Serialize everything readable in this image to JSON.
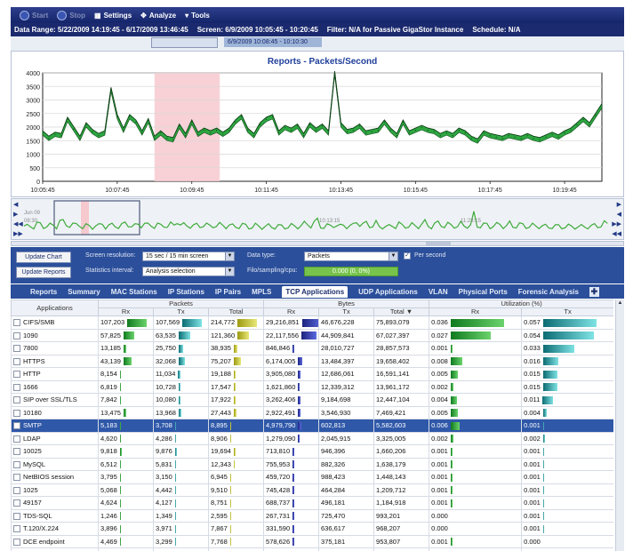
{
  "toolbar": {
    "start_label": "Start",
    "stop_label": "Stop",
    "settings_label": "Settings",
    "analyze_label": "Analyze",
    "tools_label": "Tools"
  },
  "range_bar": {
    "data_range": "Data Range: 5/22/2009 14:19:45 - 6/17/2009 13:46:45",
    "screen": "Screen: 6/9/2009 10:05:45 - 10:20:45",
    "filter": "Filter: N/A for Passive GigaStor Instance",
    "schedule": "Schedule: N/A"
  },
  "slider_label": "6/9/2009 10:08:45 - 10:10:30",
  "chart_data": {
    "type": "line",
    "title": "Reports - Packets/Second",
    "categories": [
      "10:05:45",
      "10:07:45",
      "10:09:45",
      "10:11:45",
      "10:13:45",
      "10:15:45",
      "10:17:45",
      "10:19:45"
    ],
    "y_ticks": [
      0,
      500,
      1000,
      1500,
      2000,
      2500,
      3000,
      3500,
      4000
    ],
    "ylim": [
      0,
      4000
    ],
    "xlim": [
      0,
      900
    ],
    "highlight": {
      "from": 180,
      "to": 285
    },
    "series": [
      {
        "color": "#2ea641",
        "values": [
          1700,
          1500,
          1650,
          1600,
          2200,
          1850,
          1500,
          2000,
          1750,
          1600,
          1700,
          3300,
          2300,
          1800,
          2300,
          2100,
          1700,
          2150,
          1500,
          1700,
          1500,
          1450,
          1950,
          1600,
          2100,
          1650,
          1800,
          1700,
          1800,
          1650,
          1800,
          2100,
          2300,
          1800,
          1600,
          2000,
          2200,
          2300,
          1700,
          1900,
          1800,
          1950,
          1600,
          2000,
          1800,
          1950,
          1700,
          3900,
          2000,
          1750,
          1800,
          1950,
          1700,
          1750,
          1800,
          2100,
          1800,
          1600,
          2100,
          1700,
          1800,
          1900,
          1800,
          1750,
          1600,
          1700,
          1600,
          1800,
          1700,
          1500,
          1400,
          1700,
          1600,
          1550,
          1500,
          1600,
          1550,
          1500,
          1600,
          1500,
          1450,
          1550,
          1650,
          1550,
          1700,
          1800,
          2000,
          2200,
          2000,
          2350,
          2700
        ]
      }
    ]
  },
  "overview": {
    "left_top": "Jun 09",
    "left_mid": "08:30",
    "mid_time": "10:13:15",
    "right_time": "11:23:15"
  },
  "controls": {
    "update_chart": "Update Chart",
    "update_reports": "Update Reports",
    "screen_resolution_label": "Screen resolution:",
    "screen_resolution_value": "15 sec / 15 min screen",
    "statistics_interval_label": "Statistics interval:",
    "statistics_interval_value": "Analysis selection",
    "data_type_label": "Data type:",
    "data_type_value": "Packets",
    "per_second_label": "Per second",
    "filo_label": "Filo/sampling/cpu:",
    "filo_value": "0.000 (0, 0%)"
  },
  "tabs": [
    "Reports",
    "Summary",
    "MAC Stations",
    "IP Stations",
    "IP Pairs",
    "MPLS",
    "TCP Applications",
    "UDP Applications",
    "VLAN",
    "Physical Ports",
    "Forensic Analysis"
  ],
  "active_tab": "TCP Applications",
  "table": {
    "group_headers": {
      "applications": "Applications",
      "packets": "Packets",
      "bytes": "Bytes",
      "utilization": "Utilization (%)"
    },
    "sub_headers": {
      "rx": "Rx",
      "tx": "Tx",
      "total": "Total",
      "total_sorted": "Total ▼"
    },
    "rows": [
      {
        "name": "CIFS/SMB",
        "pkt_rx": "107,203",
        "pkt_tx": "107,569",
        "pkt_total": "214,772",
        "b_rx": "29,216,851",
        "b_tx": "46,676,228",
        "b_total": "75,893,079",
        "u_rx": "0.036",
        "u_tx": "0.057"
      },
      {
        "name": "1090",
        "pkt_rx": "57,825",
        "pkt_tx": "63,535",
        "pkt_total": "121,360",
        "b_rx": "22,117,556",
        "b_tx": "44,909,841",
        "b_total": "67,027,397",
        "u_rx": "0.027",
        "u_tx": "0.054"
      },
      {
        "name": "7800",
        "pkt_rx": "13,185",
        "pkt_tx": "25,750",
        "pkt_total": "38,935",
        "b_rx": "846,846",
        "b_tx": "28,010,727",
        "b_total": "28,857,573",
        "u_rx": "0.001",
        "u_tx": "0.033"
      },
      {
        "name": "HTTPS",
        "pkt_rx": "43,139",
        "pkt_tx": "32,068",
        "pkt_total": "75,207",
        "b_rx": "6,174,005",
        "b_tx": "13,484,397",
        "b_total": "19,658,402",
        "u_rx": "0.008",
        "u_tx": "0.016"
      },
      {
        "name": "HTTP",
        "pkt_rx": "8,154",
        "pkt_tx": "11,034",
        "pkt_total": "19,188",
        "b_rx": "3,905,080",
        "b_tx": "12,686,061",
        "b_total": "16,591,141",
        "u_rx": "0.005",
        "u_tx": "0.015"
      },
      {
        "name": "1666",
        "pkt_rx": "6,819",
        "pkt_tx": "10,728",
        "pkt_total": "17,547",
        "b_rx": "1,621,860",
        "b_tx": "12,339,312",
        "b_total": "13,961,172",
        "u_rx": "0.002",
        "u_tx": "0.015"
      },
      {
        "name": "SIP over SSL/TLS",
        "pkt_rx": "7,842",
        "pkt_tx": "10,080",
        "pkt_total": "17,922",
        "b_rx": "3,262,406",
        "b_tx": "9,184,698",
        "b_total": "12,447,104",
        "u_rx": "0.004",
        "u_tx": "0.011"
      },
      {
        "name": "10180",
        "pkt_rx": "13,475",
        "pkt_tx": "13,968",
        "pkt_total": "27,443",
        "b_rx": "2,922,491",
        "b_tx": "3,546,930",
        "b_total": "7,469,421",
        "u_rx": "0.005",
        "u_tx": "0.004"
      },
      {
        "name": "SMTP",
        "pkt_rx": "5,183",
        "pkt_tx": "3,708",
        "pkt_total": "8,895",
        "b_rx": "4,979,790",
        "b_tx": "602,813",
        "b_total": "5,582,603",
        "u_rx": "0.006",
        "u_tx": "0.001"
      },
      {
        "name": "LDAP",
        "pkt_rx": "4,620",
        "pkt_tx": "4,286",
        "pkt_total": "8,906",
        "b_rx": "1,279,090",
        "b_tx": "2,045,915",
        "b_total": "3,325,005",
        "u_rx": "0.002",
        "u_tx": "0.002"
      },
      {
        "name": "10025",
        "pkt_rx": "9,818",
        "pkt_tx": "9,876",
        "pkt_total": "19,694",
        "b_rx": "713,810",
        "b_tx": "946,396",
        "b_total": "1,660,206",
        "u_rx": "0.001",
        "u_tx": "0.001"
      },
      {
        "name": "MySQL",
        "pkt_rx": "6,512",
        "pkt_tx": "5,831",
        "pkt_total": "12,343",
        "b_rx": "755,953",
        "b_tx": "882,326",
        "b_total": "1,638,179",
        "u_rx": "0.001",
        "u_tx": "0.001"
      },
      {
        "name": "NetBIOS session",
        "pkt_rx": "3,795",
        "pkt_tx": "3,150",
        "pkt_total": "6,945",
        "b_rx": "459,720",
        "b_tx": "988,423",
        "b_total": "1,448,143",
        "u_rx": "0.001",
        "u_tx": "0.001"
      },
      {
        "name": "1025",
        "pkt_rx": "5,068",
        "pkt_tx": "4,442",
        "pkt_total": "9,510",
        "b_rx": "745,428",
        "b_tx": "464,284",
        "b_total": "1,209,712",
        "u_rx": "0.001",
        "u_tx": "0.001"
      },
      {
        "name": "49157",
        "pkt_rx": "4,624",
        "pkt_tx": "4,127",
        "pkt_total": "8,751",
        "b_rx": "688,737",
        "b_tx": "496,181",
        "b_total": "1,184,918",
        "u_rx": "0.001",
        "u_tx": "0.001"
      },
      {
        "name": "TDS-SQL",
        "pkt_rx": "1,246",
        "pkt_tx": "1,349",
        "pkt_total": "2,595",
        "b_rx": "267,731",
        "b_tx": "725,470",
        "b_total": "993,201",
        "u_rx": "0.000",
        "u_tx": "0.001"
      },
      {
        "name": "T.120/X.224",
        "pkt_rx": "3,896",
        "pkt_tx": "3,971",
        "pkt_total": "7,867",
        "b_rx": "331,590",
        "b_tx": "636,617",
        "b_total": "968,207",
        "u_rx": "0.000",
        "u_tx": "0.001"
      },
      {
        "name": "DCE endpoint",
        "pkt_rx": "4,469",
        "pkt_tx": "3,299",
        "pkt_total": "7,768",
        "b_rx": "578,626",
        "b_tx": "375,181",
        "b_total": "953,807",
        "u_rx": "0.001",
        "u_tx": "0.000"
      },
      {
        "name": "1689",
        "pkt_rx": "1,100",
        "pkt_tx": "768",
        "pkt_total": "1,868",
        "b_rx": "369,109",
        "b_tx": "113,976",
        "b_total": "483,085",
        "u_rx": "0.000",
        "u_tx": "0.000"
      },
      {
        "name": "10032",
        "pkt_rx": "1,665",
        "pkt_tx": "1,485",
        "pkt_total": "3,150",
        "b_rx": "170,830",
        "b_tx": "249,447",
        "b_total": "420,277",
        "u_rx": "0.000",
        "u_tx": "0.000"
      }
    ],
    "selected_row": 8
  }
}
